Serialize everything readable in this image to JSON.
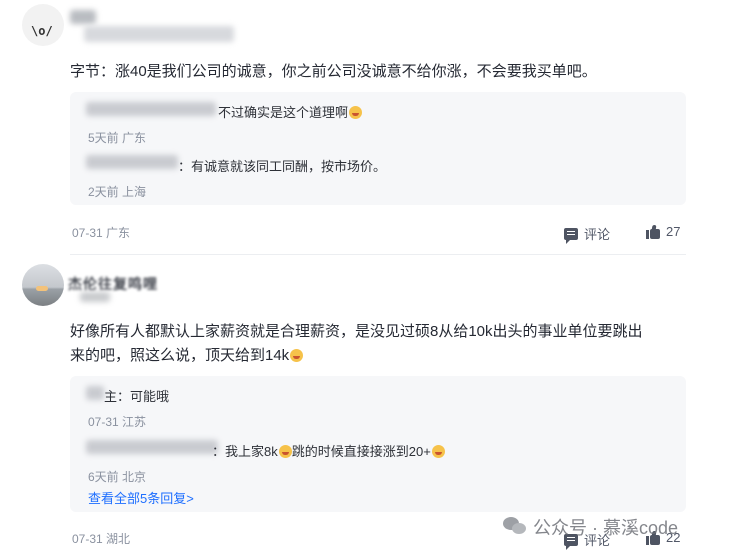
{
  "comments": [
    {
      "content": "字节：涨40是我们公司的诚意，你之前公司没诚意不给你涨，不会要我买单吧。",
      "replies": [
        {
          "text": "不过确实是这个道理啊",
          "meta": "5天前 广东",
          "emoji": "smile"
        },
        {
          "text": "：有诚意就该同工同酬，按市场价。",
          "meta": "2天前 上海"
        }
      ],
      "date_location": "07-31 广东",
      "comment_label": "评论",
      "like_count": "27"
    },
    {
      "author_partial": "杰伦往复鸣哩",
      "content_line1": "好像所有人都默认上家薪资就是合理薪资，是没见过硕8从给10k出头的事业单位要跳出",
      "content_line2": "来的吧，照这么说，顶天给到14k",
      "replies": [
        {
          "prefix": "主：",
          "text": "可能哦",
          "meta": "07-31 江苏"
        },
        {
          "text_a": "：我上家8k",
          "text_b": "跳的时候直接接涨到20+",
          "meta": "6天前 北京"
        }
      ],
      "view_all": "查看全部5条回复>",
      "date_location": "07-31 湖北",
      "comment_label": "评论",
      "like_count": "22"
    }
  ],
  "watermark": "公众号 · 慕溪code"
}
